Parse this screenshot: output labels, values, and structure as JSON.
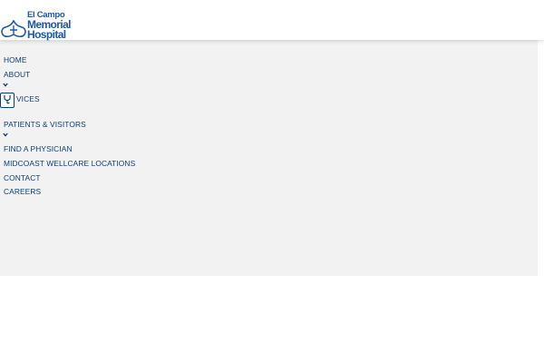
{
  "logo": {
    "line1": "El Campo",
    "line2": "Memorial",
    "line3": "Hospital",
    "color": "#1e5aa8"
  },
  "nav": {
    "items": [
      {
        "label": "HOME"
      },
      {
        "label": "ABOUT",
        "has_submenu": true
      },
      {
        "label": "SERVICES",
        "visible_label": "VICES",
        "has_submenu": false,
        "icon": "stethoscope-icon"
      },
      {
        "label": "PATIENTS & VISITORS",
        "has_submenu": true
      },
      {
        "label": "FIND A PHYSICIAN"
      },
      {
        "label": "MIDCOAST WELLCARE LOCATIONS"
      },
      {
        "label": "CONTACT"
      },
      {
        "label": "CAREERS"
      }
    ],
    "text_color": "#0c3f76",
    "panel_color": "#f2f2f2"
  }
}
